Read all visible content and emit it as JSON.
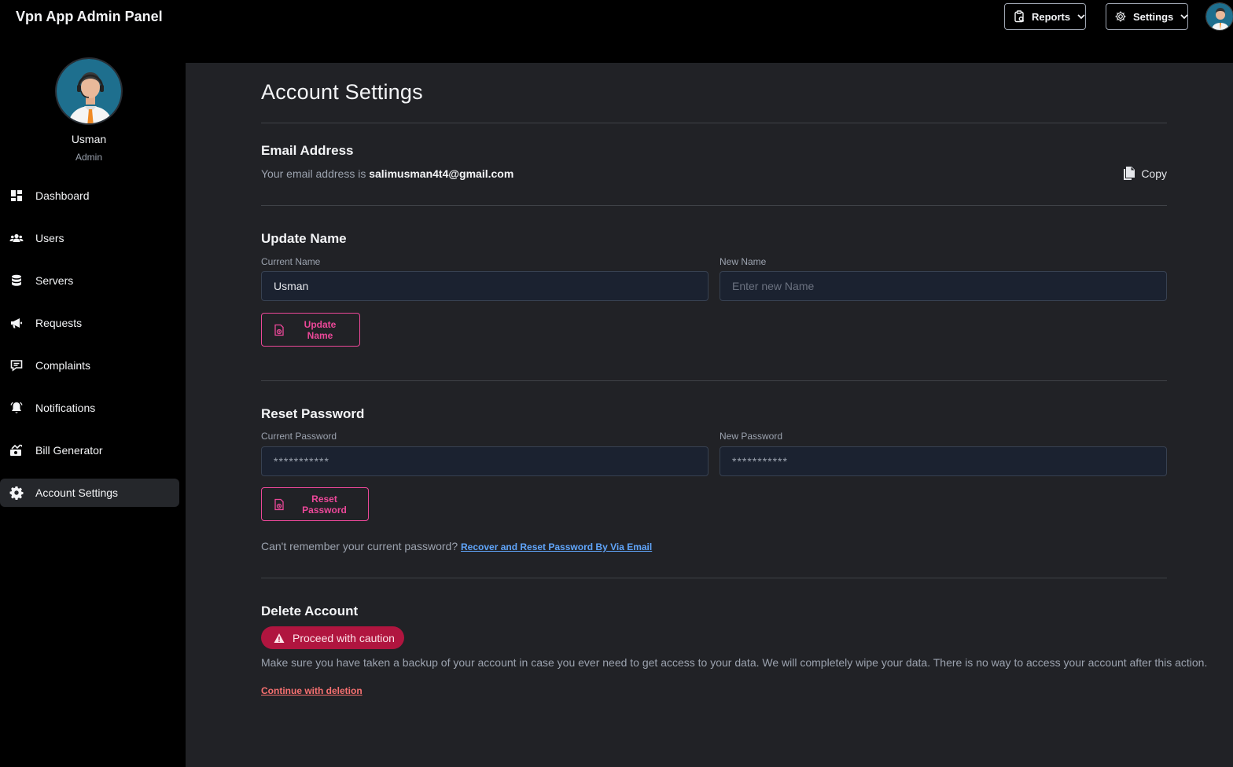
{
  "app": {
    "title": "Vpn App Admin Panel"
  },
  "topbar": {
    "reports_label": "Reports",
    "settings_label": "Settings"
  },
  "profile": {
    "name": "Usman",
    "role": "Admin"
  },
  "sidebar": {
    "items": [
      {
        "label": "Dashboard",
        "icon": "dashboard-icon"
      },
      {
        "label": "Users",
        "icon": "users-icon"
      },
      {
        "label": "Servers",
        "icon": "database-icon"
      },
      {
        "label": "Requests",
        "icon": "megaphone-icon"
      },
      {
        "label": "Complaints",
        "icon": "chat-icon"
      },
      {
        "label": "Notifications",
        "icon": "bell-icon"
      },
      {
        "label": "Bill Generator",
        "icon": "money-icon"
      },
      {
        "label": "Account Settings",
        "icon": "gear-icon",
        "active": true
      }
    ]
  },
  "page": {
    "title": "Account Settings"
  },
  "email": {
    "title": "Email Address",
    "prefix": "Your email address is ",
    "address": "salimusman4t4@gmail.com",
    "copy_label": "Copy"
  },
  "update_name": {
    "title": "Update Name",
    "current_label": "Current Name",
    "current_value": "Usman",
    "new_label": "New Name",
    "new_placeholder": "Enter new Name",
    "button_label": "Update Name"
  },
  "reset_password": {
    "title": "Reset Password",
    "current_label": "Current Password",
    "current_placeholder": "***********",
    "new_label": "New Password",
    "new_placeholder": "***********",
    "button_label": "Reset Password",
    "recover_prefix": "Can't remember your current password? ",
    "recover_link": "Recover and Reset Password By Via Email"
  },
  "delete_account": {
    "title": "Delete Account",
    "badge": "Proceed with caution",
    "description": "Make sure you have taken a backup of your account in case you ever need to get access to your data. We will completely wipe your data. There is no way to access your account after this action.",
    "link": "Continue with deletion"
  },
  "colors": {
    "accent_pink": "#ec4899",
    "danger": "#b0153f",
    "link_blue": "#60a5fa",
    "main_bg": "#212226",
    "sidebar_bg": "#000000"
  }
}
